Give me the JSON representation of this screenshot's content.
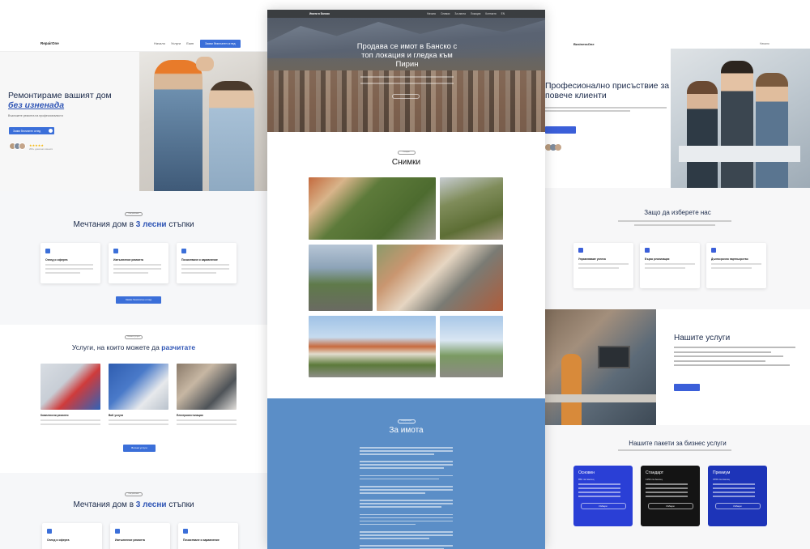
{
  "left": {
    "logo": "RepairOne",
    "nav": [
      "Начало",
      "Услуги",
      "Екип"
    ],
    "nav_button": "Заяви безплатен оглед",
    "hero_title": "Ремонтираме вашият дом",
    "hero_title_em": "без изненада",
    "hero_sub": "Възложете ремонта на професионалисти",
    "hero_button": "Заяви безплатен оглед",
    "stars": "★★★★★",
    "rating_text": "200+ доволни клиенти",
    "steps": {
      "tag": "Как работим",
      "title_a": "Мечтания дом в",
      "title_em": "3 лесни",
      "title_b": "стъпки",
      "cards": [
        "Оглед и оферта",
        "Изпълнение ремонта",
        "Почистване и заравнение"
      ],
      "button": "Заяви безплатен оглед"
    },
    "services": {
      "tag": "Нашите услуги",
      "title_a": "Услуги, на които можете да",
      "title_em": "разчитате",
      "items": [
        "Комплексни ремонти",
        "ВиК услуги",
        "Електроинсталации"
      ],
      "button": "Всички услуги"
    },
    "steps2": {
      "tag": "Как работим",
      "title_a": "Мечтания дом в",
      "title_em": "3 лесни",
      "title_b": "стъпки",
      "cards": [
        "Оглед и оферта",
        "Изпълнение ремонта",
        "Почистване и заравнение"
      ]
    }
  },
  "center": {
    "logo": "Имоти в Банско",
    "nav": [
      "Начало",
      "Снимки",
      "За имота",
      "Локация",
      "Контакти",
      "EN"
    ],
    "hero_title": "Продава се имот в Банско с топ локация и гледка към Пирин",
    "photos_tag": "Галерия",
    "photos_title": "Снимки",
    "about_tag": "Информация",
    "about_title": "За имота"
  },
  "right": {
    "logo": "BusinessOne",
    "nav_item": "Начало",
    "hero_title": "Професионално присъствие за повече клиенти",
    "why_title": "Защо да изберете нас",
    "why_cards": [
      "Управляваме успеха",
      "Бързо реализация",
      "Дългосрочно партньорство"
    ],
    "services_title": "Нашите услуги",
    "packages_title": "Нашите пакети за бизнес услуги",
    "packages": [
      {
        "name": "Основен",
        "price": "850 лв./месец",
        "button": "Избери",
        "color": "#2a3fd6"
      },
      {
        "name": "Стандарт",
        "price": "1150 лв./месец",
        "button": "Избери",
        "color": "#141414"
      },
      {
        "name": "Премиум",
        "price": "1550 лв./месец",
        "button": "Избери",
        "color": "#1d34b8"
      }
    ]
  },
  "colors": {
    "accent": "#3b6fd9",
    "about_bg": "#5b8ec7",
    "hero_overlay": "#3a3d40"
  }
}
